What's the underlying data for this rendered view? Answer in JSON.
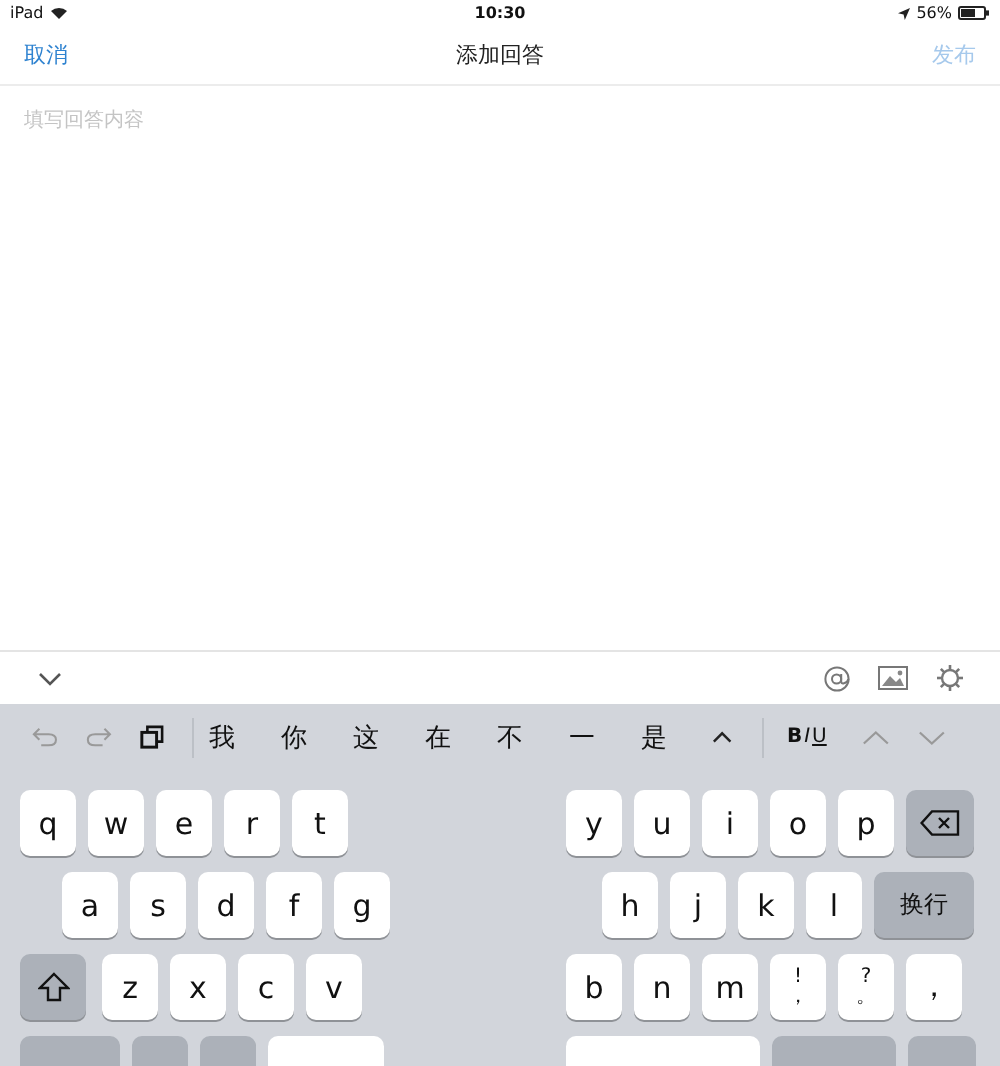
{
  "status_bar": {
    "device": "iPad",
    "time": "10:30",
    "battery": "56%"
  },
  "nav_bar": {
    "cancel": "取消",
    "title": "添加回答",
    "publish": {
      "label": "发布",
      "disabled": true
    }
  },
  "editor": {
    "placeholder": "填写回答内容"
  },
  "candidate_bar": {
    "candidates": [
      "我",
      "你",
      "这",
      "在",
      "不",
      "一",
      "是"
    ],
    "format": [
      {
        "label": "B",
        "kind": "bold"
      },
      {
        "label": "I",
        "kind": "italic"
      },
      {
        "label": "U",
        "kind": "underline"
      }
    ]
  },
  "keyboard": {
    "left_rows": [
      [
        {
          "label": "q",
          "kind": "letter"
        },
        {
          "label": "w",
          "kind": "letter"
        },
        {
          "label": "e",
          "kind": "letter"
        },
        {
          "label": "r",
          "kind": "letter"
        },
        {
          "label": "t",
          "kind": "letter"
        }
      ],
      [
        {
          "label": "a",
          "kind": "letter"
        },
        {
          "label": "s",
          "kind": "letter"
        },
        {
          "label": "d",
          "kind": "letter"
        },
        {
          "label": "f",
          "kind": "letter"
        },
        {
          "label": "g",
          "kind": "letter"
        }
      ],
      [
        {
          "kind": "shift"
        },
        {
          "label": "z",
          "kind": "letter"
        },
        {
          "label": "x",
          "kind": "letter"
        },
        {
          "label": "c",
          "kind": "letter"
        },
        {
          "label": "v",
          "kind": "letter"
        }
      ],
      [
        {
          "kind": "function"
        },
        {
          "kind": "function"
        },
        {
          "kind": "function"
        },
        {
          "kind": "space"
        }
      ]
    ],
    "right_rows": [
      [
        {
          "label": "y",
          "kind": "letter"
        },
        {
          "label": "u",
          "kind": "letter"
        },
        {
          "label": "i",
          "kind": "letter"
        },
        {
          "label": "o",
          "kind": "letter"
        },
        {
          "label": "p",
          "kind": "letter"
        },
        {
          "kind": "backspace"
        }
      ],
      [
        {
          "label": "h",
          "kind": "letter"
        },
        {
          "label": "j",
          "kind": "letter"
        },
        {
          "label": "k",
          "kind": "letter"
        },
        {
          "label": "l",
          "kind": "letter"
        },
        {
          "label": "换行",
          "kind": "return"
        }
      ],
      [
        {
          "label": "b",
          "kind": "letter"
        },
        {
          "label": "n",
          "kind": "letter"
        },
        {
          "label": "m",
          "kind": "letter"
        },
        {
          "label": "!",
          "sub": "，",
          "kind": "punct"
        },
        {
          "label": "?",
          "sub": "。",
          "kind": "punct"
        },
        {
          "label": "，",
          "kind": "letter"
        }
      ],
      [
        {
          "kind": "space"
        },
        {
          "kind": "function"
        },
        {
          "kind": "function"
        }
      ]
    ]
  }
}
